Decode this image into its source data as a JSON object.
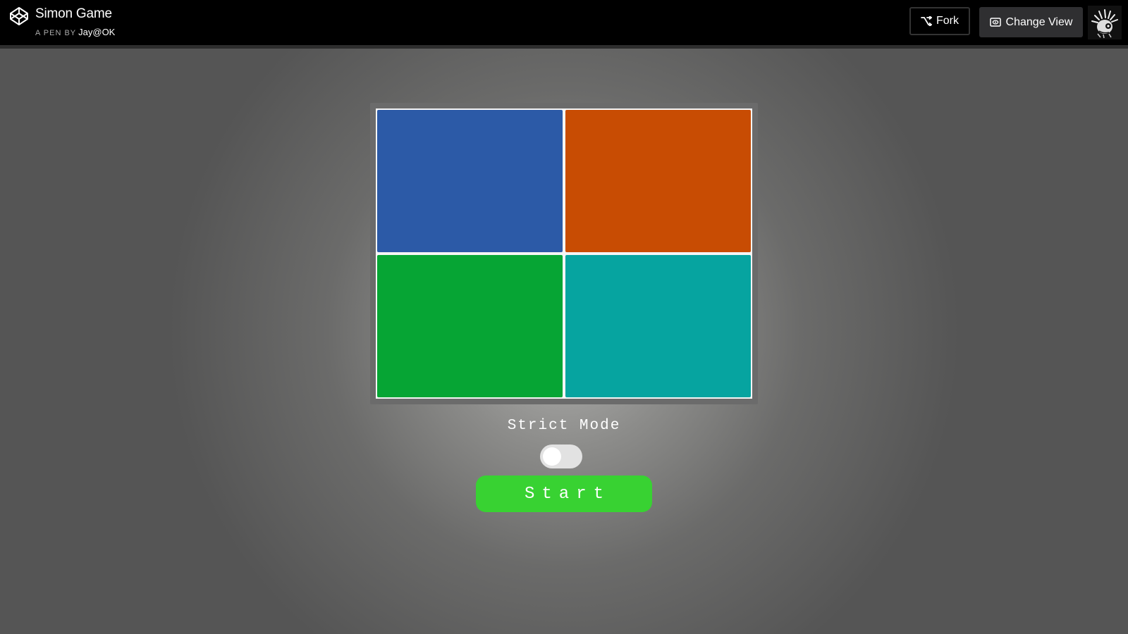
{
  "header": {
    "title": "Simon Game",
    "byline_prefix": "A PEN BY",
    "author": "Jay@OK",
    "fork_label": "Fork",
    "change_view_label": "Change View",
    "logo_icon": "codepen-icon",
    "fork_icon": "fork-icon",
    "view_icon": "eye-icon"
  },
  "game": {
    "pads": [
      {
        "name": "blue",
        "color": "#2c5aa7"
      },
      {
        "name": "orange",
        "color": "#c84c03"
      },
      {
        "name": "green",
        "color": "#06a534"
      },
      {
        "name": "teal",
        "color": "#06a4a0"
      }
    ],
    "strict_label": "Strict Mode",
    "strict_enabled": false,
    "start_label": "Start",
    "start_color": "#38d232"
  }
}
